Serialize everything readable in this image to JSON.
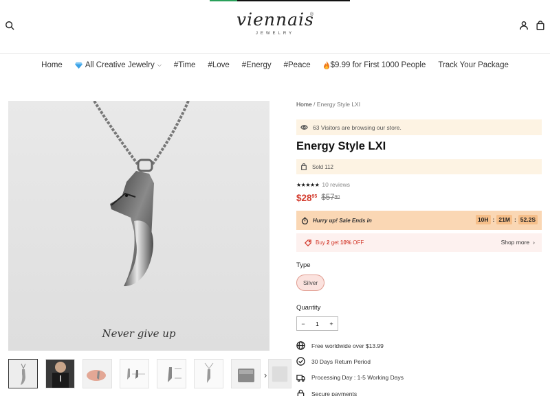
{
  "header": {
    "logo_word": "viennais",
    "logo_reg": "®",
    "logo_sub": "JEWELRY",
    "icons": [
      "search-icon",
      "account-icon",
      "cart-icon"
    ]
  },
  "nav": {
    "items": [
      {
        "label": "Home"
      },
      {
        "label": "All Creative Jewelry",
        "icon": "gem-icon"
      },
      {
        "label": "#Time"
      },
      {
        "label": "#Love"
      },
      {
        "label": "#Energy"
      },
      {
        "label": "#Peace"
      },
      {
        "label": "$9.99 for First 1000 People",
        "icon": "flame-icon"
      },
      {
        "label": "Track Your Package"
      }
    ]
  },
  "gallery": {
    "caption": "Never give up",
    "thumb_count": 8
  },
  "product": {
    "breadcrumb_home": "Home",
    "breadcrumb_sep": " / ",
    "breadcrumb_current": "Energy Style LXI",
    "visitors": "63 Visitors are browsing our store.",
    "title": "Energy Style LXI",
    "sold": "Sold 112",
    "stars": "★★★★★",
    "rating": 5,
    "reviews": "10 reviews",
    "price_main": "$28",
    "price_cents": "95",
    "old_main": "$57",
    "old_cents": "90",
    "hurry": "Hurry up! Sale Ends in",
    "timer": {
      "hours": "10H",
      "minutes": "21M",
      "seconds": "52.2S",
      "sep": ":"
    },
    "offer_pre": "Buy ",
    "offer_qty": "2",
    "offer_mid": " get ",
    "offer_pct": "10%",
    "offer_post": " OFF",
    "shop_more": "Shop more",
    "type_label": "Type",
    "variant": "Silver",
    "quantity_label": "Quantity",
    "quantity": "1",
    "minus": "−",
    "plus": "+",
    "features": [
      {
        "icon": "globe-icon",
        "text": "Free worldwide over $13.99"
      },
      {
        "icon": "check-circle-icon",
        "text": "30 Days Return Period"
      },
      {
        "icon": "truck-icon",
        "text": "Processing Day : 1-5 Working Days"
      },
      {
        "icon": "lock-icon",
        "text": "Secure payments"
      }
    ]
  },
  "colors": {
    "price": "#d33a2c",
    "cream_bg": "#fdf3e3",
    "sale_bg": "#fad7b4",
    "offer_bg": "#fdf1ef",
    "variant_border": "#e09b8f"
  }
}
